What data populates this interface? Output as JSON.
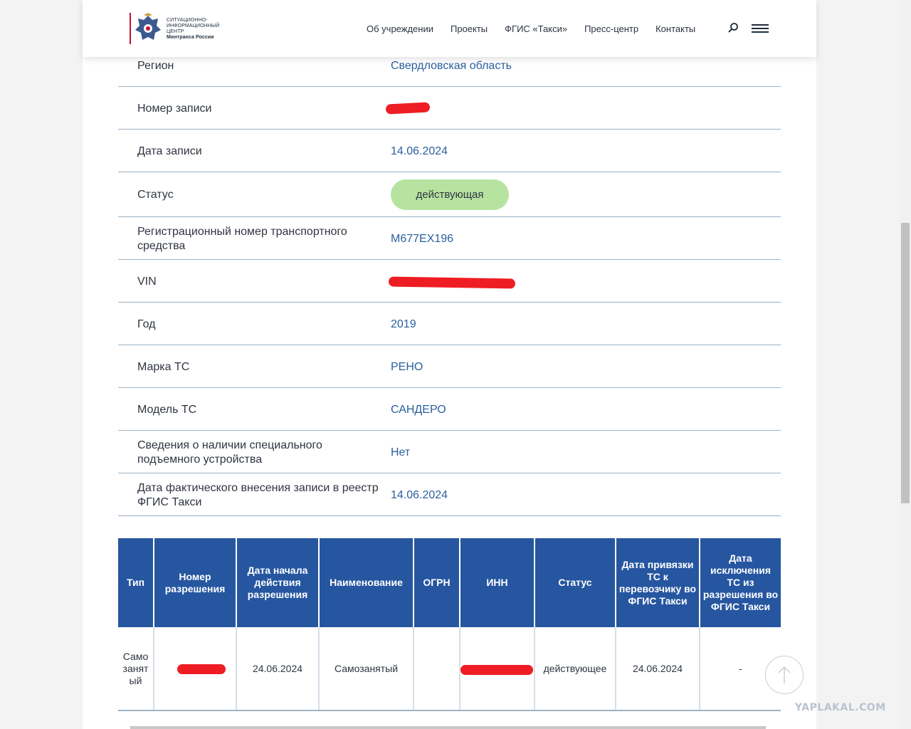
{
  "header": {
    "logo_lines": [
      "Ситуационно-",
      "информационный",
      "центр"
    ],
    "logo_strong": "Минтранса России",
    "nav": [
      "Об учреждении",
      "Проекты",
      "ФГИС «Такси»",
      "Пресс-центр",
      "Контакты"
    ]
  },
  "details": [
    {
      "label": "Регион",
      "value": "Свердловская область"
    },
    {
      "label": "Номер записи",
      "value": ""
    },
    {
      "label": "Дата записи",
      "value": "14.06.2024"
    },
    {
      "label": "Статус",
      "value": "действующая"
    },
    {
      "label": "Регистрационный номер транспортного средства",
      "value": "М677ЕХ196"
    },
    {
      "label": "VIN",
      "value": ""
    },
    {
      "label": "Год",
      "value": "2019"
    },
    {
      "label": "Марка ТС",
      "value": "РЕНО"
    },
    {
      "label": "Модель ТС",
      "value": "САНДЕРО"
    },
    {
      "label": "Сведения о наличии специального подъемного устройства",
      "value": "Нет"
    },
    {
      "label": "Дата фактического внесения записи в реестр ФГИС Такси",
      "value": "14.06.2024"
    }
  ],
  "permits": {
    "headers": [
      "Тип",
      "Номер разрешения",
      "Дата начала действия разрешения",
      "Наименование",
      "ОГРН",
      "ИНН",
      "Статус",
      "Дата привязки ТС к перевозчику во ФГИС Такси",
      "Дата исключения ТС из разрешения во ФГИС Такси"
    ],
    "row": [
      "Самозанятый",
      "",
      "24.06.2024",
      "Самозанятый",
      "",
      "",
      "действующее",
      "24.06.2024",
      "-"
    ]
  },
  "watermark": "YAPLAKAL.COM",
  "colors": {
    "accent": "#2656a0",
    "value_text": "#2a5f9e",
    "status_badge": "#b7e3a1",
    "redaction": "#ee1d23"
  }
}
